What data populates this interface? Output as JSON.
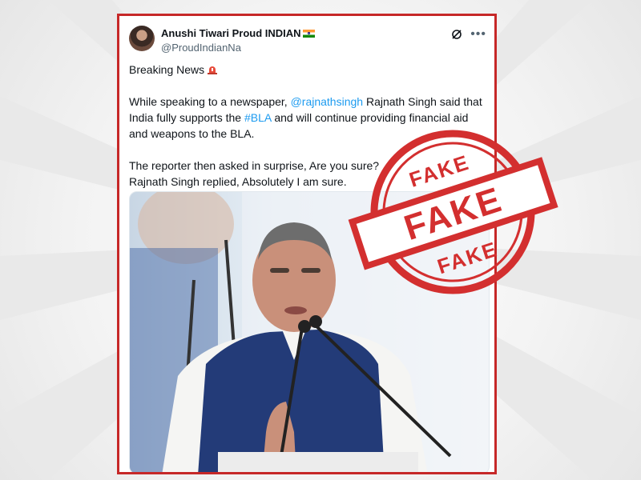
{
  "tweet": {
    "author_name": "Anushi Tiwari Proud INDIAN",
    "author_handle": "@ProudIndianNa",
    "headline": "Breaking News",
    "line1_pre": "While speaking to a newspaper, ",
    "mention": "@rajnathsingh",
    "line1_post": " Rajnath Singh said that India fully supports the ",
    "hashtag": "#BLA",
    "line1_end": " and will continue providing financial aid and weapons to the BLA.",
    "line2": "The reporter then asked in surprise, Are you sure?",
    "line3": "Rajnath Singh replied, Absolutely I am sure."
  },
  "stamp": {
    "word_top": "FAKE",
    "word_center": "FAKE",
    "word_bottom": "FAKE",
    "color": "#d32f2f"
  },
  "colors": {
    "frame_border": "#c62828",
    "link": "#1d9bf0"
  },
  "icons": [
    "grok-icon",
    "more-icon",
    "siren-icon",
    "india-flag-icon"
  ]
}
